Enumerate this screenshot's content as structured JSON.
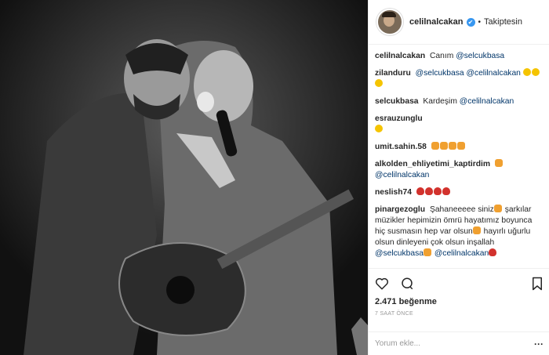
{
  "post": {
    "username": "celilnalcakan",
    "separator": "•",
    "follow_label": "Takiptesin",
    "verified_glyph": "✔"
  },
  "comments": [
    {
      "user": "celilnalcakan",
      "text": "Canım",
      "mentions": [
        "@selcukbasa"
      ]
    },
    {
      "user": "zilanduru",
      "mentions": [
        "@selcukbasa",
        "@celilnalcakan"
      ]
    },
    {
      "user": "selcukbasa",
      "text": "Kardeşim",
      "mentions": [
        "@celilnalcakan"
      ]
    },
    {
      "user": "esrauzunglu"
    },
    {
      "user": "umit.sahin.58"
    },
    {
      "user": "alkolden_ehliyetimi_kaptirdim",
      "mentions": [
        "@celilnalcakan"
      ]
    },
    {
      "user": "neslish74"
    },
    {
      "user": "pinargezoglu",
      "text1": "Şahaneeeee siniz",
      "text2": "şarkılar müzikler hepimizin ömrü hayatımız boyunca hiç susmasın hep var olsun",
      "text3": "hayırlı uğurlu olsun dinleyeni çok olsun inşallah",
      "mentions": [
        "@selcukbasa",
        "@celilnalcakan"
      ]
    }
  ],
  "actions": {
    "likes": "2.471 beğenme",
    "time": "7 SAAT ÖNCE",
    "add_comment_placeholder": "Yorum ekle...",
    "more_glyph": "···"
  },
  "icons": [
    "heart-icon",
    "comment-icon",
    "bookmark-icon",
    "more-icon",
    "verified-icon"
  ],
  "colors": {
    "link": "#003569",
    "verified": "#3897f0",
    "muted": "#999999"
  }
}
